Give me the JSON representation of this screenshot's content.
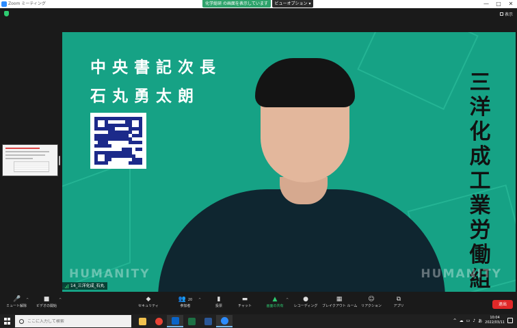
{
  "titlebar": {
    "app_title": "Zoom ミーティング",
    "share_banner": "化学総研 の画面を表示しています",
    "view_options": "ビューオプション ▾",
    "controls": [
      "—",
      "□",
      "✕"
    ]
  },
  "view_toggle": {
    "label": "表示"
  },
  "slide": {
    "title": "中央書記次長",
    "name": "石丸勇太朗",
    "union_name": "三洋化成工業労働組合",
    "watermark_left": "HUMANITY",
    "watermark_right": "HUMANITY"
  },
  "name_tag": {
    "label": "14_三洋化成_石丸"
  },
  "toolbar": {
    "mute": "ミュート解除",
    "video": "ビデオの開始",
    "security": "セキュリティ",
    "participants": "参加者",
    "participants_count": "20",
    "polls": "投票",
    "chat": "チャット",
    "share": "画面の共有",
    "record": "レコーディング",
    "breakout": "ブレイクアウト ルーム",
    "reactions": "リアクション",
    "apps": "アプリ",
    "leave": "退出"
  },
  "taskbar": {
    "search_placeholder": "ここに入力して検索",
    "time": "10:04",
    "date": "2022/03/11",
    "ime": "あ"
  }
}
